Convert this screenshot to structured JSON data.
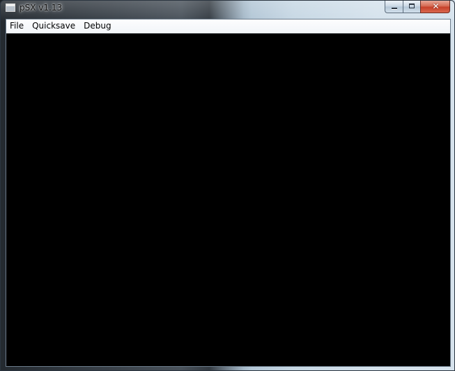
{
  "window": {
    "title": "pSX v1.13",
    "icon": "app-window-icon",
    "close_glyph": "✕"
  },
  "menu": {
    "items": [
      {
        "label": "File"
      },
      {
        "label": "Quicksave"
      },
      {
        "label": "Debug"
      }
    ]
  },
  "colors": {
    "display_background": "#000000",
    "menu_background": "#f6f8fb"
  }
}
